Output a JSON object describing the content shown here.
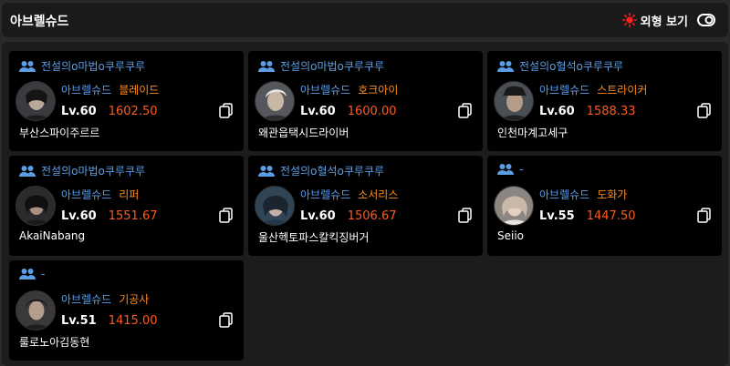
{
  "header": {
    "title": "아브렐슈드",
    "view_label": "외형 보기",
    "accent": "#ff1f1f"
  },
  "colors": {
    "guild": "#5b9ee6",
    "server": "#5b9ee6",
    "class": "#ff8c1a",
    "power": "#ff5a1f"
  },
  "characters": [
    {
      "guild": "전설의o마법o쿠루쿠루",
      "server": "아브렐슈드",
      "class": "블레이드",
      "level": "Lv.60",
      "power": "1602.50",
      "name": "부산스파이주르르"
    },
    {
      "guild": "전설의o마법o쿠루쿠루",
      "server": "아브렐슈드",
      "class": "호크아이",
      "level": "Lv.60",
      "power": "1600.00",
      "name": "왜관읍택시드라이버"
    },
    {
      "guild": "전설의o혈석o쿠루쿠루",
      "server": "아브렐슈드",
      "class": "스트라이커",
      "level": "Lv.60",
      "power": "1588.33",
      "name": "인천마계고세구"
    },
    {
      "guild": "전설의o마법o쿠루쿠루",
      "server": "아브렐슈드",
      "class": "리퍼",
      "level": "Lv.60",
      "power": "1551.67",
      "name": "AkaiNabang"
    },
    {
      "guild": "전설의o혈석o쿠루쿠루",
      "server": "아브렐슈드",
      "class": "소서리스",
      "level": "Lv.60",
      "power": "1506.67",
      "name": "울산헥토파스칼킥징버거"
    },
    {
      "guild": "-",
      "server": "아브렐슈드",
      "class": "도화가",
      "level": "Lv.55",
      "power": "1447.50",
      "name": "Seiio"
    },
    {
      "guild": "-",
      "server": "아브렐슈드",
      "class": "기공사",
      "level": "Lv.51",
      "power": "1415.00",
      "name": "룰로노아김동현"
    }
  ]
}
